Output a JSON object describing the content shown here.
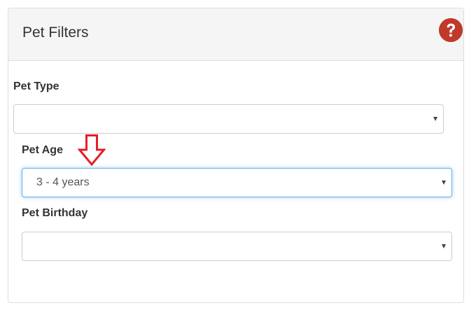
{
  "panel": {
    "title": "Pet Filters",
    "help_icon": "question-circle-icon",
    "help_icon_color": "#c0392b"
  },
  "filters": {
    "pet_type": {
      "label": "Pet Type",
      "value": ""
    },
    "pet_age": {
      "label": "Pet Age",
      "value": "3 - 4 years"
    },
    "pet_birthday": {
      "label": "Pet Birthday",
      "value": ""
    }
  },
  "annotation": {
    "icon": "down-arrow-icon",
    "color": "#e3202a"
  },
  "colors": {
    "focus_border": "#66afe9",
    "heading_background": "#f5f5f5"
  }
}
